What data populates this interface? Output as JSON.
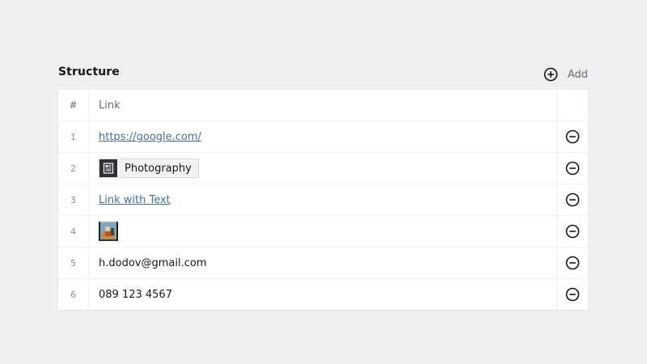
{
  "section": {
    "title": "Structure",
    "add_label": "Add"
  },
  "table": {
    "columns": [
      "#",
      "Link"
    ],
    "rows": [
      {
        "index": "1",
        "type": "link",
        "text": "https://google.com/"
      },
      {
        "index": "2",
        "type": "page",
        "text": "Photography"
      },
      {
        "index": "3",
        "type": "link",
        "text": "Link with Text"
      },
      {
        "index": "4",
        "type": "image",
        "text": ""
      },
      {
        "index": "5",
        "type": "text",
        "text": "h.dodov@gmail.com"
      },
      {
        "index": "6",
        "type": "text",
        "text": "089 123 4567"
      }
    ]
  },
  "icons": {
    "add": "plus-circle-icon",
    "remove": "minus-circle-icon",
    "page": "document-icon"
  },
  "colors": {
    "background": "#efeef0",
    "link": "#3f6fa8",
    "icon": "#16171a"
  }
}
